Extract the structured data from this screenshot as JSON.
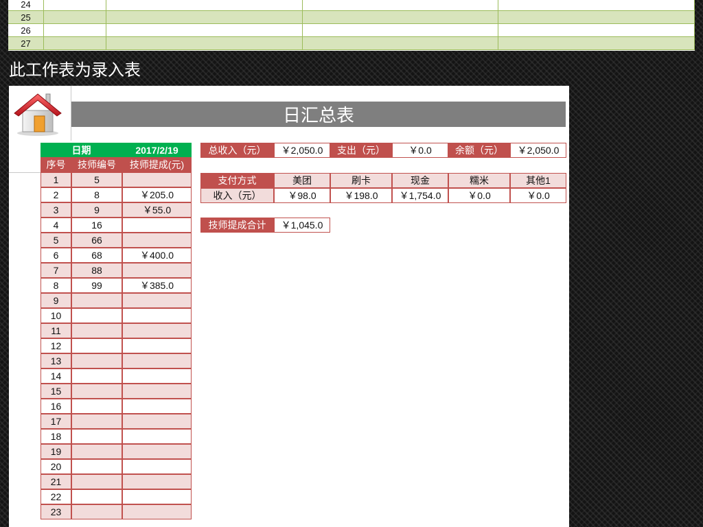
{
  "top_sheet": {
    "rows": [
      {
        "num": "24",
        "style": "white"
      },
      {
        "num": "25",
        "style": "green"
      },
      {
        "num": "26",
        "style": "white"
      },
      {
        "num": "27",
        "style": "green"
      }
    ]
  },
  "caption": "此工作表为录入表",
  "title": "日汇总表",
  "left_table": {
    "date_label": "日期",
    "date_value": "2017/2/19",
    "headers": [
      "序号",
      "技师编号",
      "技师提成(元)"
    ],
    "rows": [
      {
        "seq": "1",
        "tech": "5",
        "commission": ""
      },
      {
        "seq": "2",
        "tech": "8",
        "commission": "￥205.0"
      },
      {
        "seq": "3",
        "tech": "9",
        "commission": "￥55.0"
      },
      {
        "seq": "4",
        "tech": "16",
        "commission": ""
      },
      {
        "seq": "5",
        "tech": "66",
        "commission": ""
      },
      {
        "seq": "6",
        "tech": "68",
        "commission": "￥400.0"
      },
      {
        "seq": "7",
        "tech": "88",
        "commission": ""
      },
      {
        "seq": "8",
        "tech": "99",
        "commission": "￥385.0"
      },
      {
        "seq": "9",
        "tech": "",
        "commission": ""
      },
      {
        "seq": "10",
        "tech": "",
        "commission": ""
      },
      {
        "seq": "11",
        "tech": "",
        "commission": ""
      },
      {
        "seq": "12",
        "tech": "",
        "commission": ""
      },
      {
        "seq": "13",
        "tech": "",
        "commission": ""
      },
      {
        "seq": "14",
        "tech": "",
        "commission": ""
      },
      {
        "seq": "15",
        "tech": "",
        "commission": ""
      },
      {
        "seq": "16",
        "tech": "",
        "commission": ""
      },
      {
        "seq": "17",
        "tech": "",
        "commission": ""
      },
      {
        "seq": "18",
        "tech": "",
        "commission": ""
      },
      {
        "seq": "19",
        "tech": "",
        "commission": ""
      },
      {
        "seq": "20",
        "tech": "",
        "commission": ""
      },
      {
        "seq": "21",
        "tech": "",
        "commission": ""
      },
      {
        "seq": "22",
        "tech": "",
        "commission": ""
      },
      {
        "seq": "23",
        "tech": "",
        "commission": ""
      }
    ]
  },
  "summary": {
    "total_income_label": "总收入（元）",
    "total_income_value": "￥2,050.0",
    "expense_label": "支出（元）",
    "expense_value": "￥0.0",
    "balance_label": "余额（元）",
    "balance_value": "￥2,050.0"
  },
  "payment": {
    "method_label": "支付方式",
    "income_label": "收入（元）",
    "methods": [
      {
        "name": "美团",
        "income": "￥98.0"
      },
      {
        "name": "刷卡",
        "income": "￥198.0"
      },
      {
        "name": "现金",
        "income": "￥1,754.0"
      },
      {
        "name": "糯米",
        "income": "￥0.0"
      },
      {
        "name": "其他1",
        "income": "￥0.0"
      }
    ]
  },
  "commission_total": {
    "label": "技师提成合计",
    "value": "￥1,045.0"
  },
  "icons": {
    "house": "home-icon"
  },
  "colors": {
    "header_red": "#c0504d",
    "header_green": "#00b050",
    "row_pink": "#f2dcdb",
    "banner_gray": "#7f7f7f",
    "sheet_green": "#d8e4bc"
  }
}
